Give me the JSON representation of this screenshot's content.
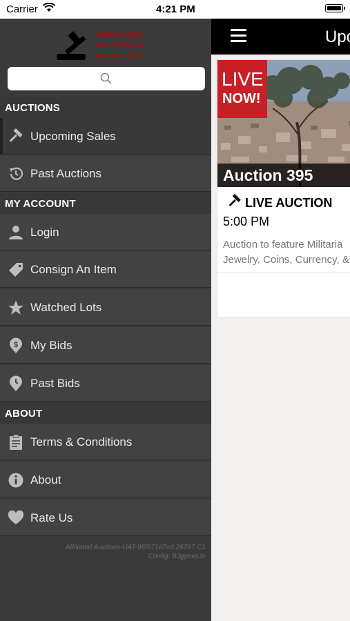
{
  "status": {
    "carrier": "Carrier",
    "time": "4:21 PM"
  },
  "brand": {
    "logo_text": [
      "AFFILIATED",
      "AUCTIONS &",
      "REALTY LLC"
    ]
  },
  "search": {
    "placeholder": ""
  },
  "sidebar": {
    "sections": [
      {
        "title": "AUCTIONS",
        "items": [
          {
            "label": "Upcoming Sales",
            "icon": "gavel-icon"
          },
          {
            "label": "Past Auctions",
            "icon": "history-icon"
          }
        ]
      },
      {
        "title": "MY ACCOUNT",
        "items": [
          {
            "label": "Login",
            "icon": "person-icon"
          },
          {
            "label": "Consign An Item",
            "icon": "tag-icon"
          },
          {
            "label": "Watched Lots",
            "icon": "star-icon"
          },
          {
            "label": "My Bids",
            "icon": "dollar-pin-icon"
          },
          {
            "label": "Past Bids",
            "icon": "clock-pin-icon"
          }
        ]
      },
      {
        "title": "ABOUT",
        "items": [
          {
            "label": "Terms & Conditions",
            "icon": "clipboard-icon"
          },
          {
            "label": "About",
            "icon": "info-icon"
          },
          {
            "label": "Rate Us",
            "icon": "heart-icon"
          }
        ]
      }
    ],
    "footer": {
      "line1": "Affiliated Auctions-UAT-96f571d7ed.26767.C1",
      "line2": "Config: BJgyexeJo"
    }
  },
  "main": {
    "page_title": "Upcoming Sales",
    "card": {
      "live_line1": "LIVE",
      "live_line2": "NOW!",
      "auction_title": "Auction 395",
      "type": "LIVE AUCTION",
      "time": "5:00 PM",
      "desc_line1": "Auction to feature Militaria",
      "desc_line2": "Jewelry, Coins, Currency, &"
    }
  },
  "colors": {
    "sidebar_bg": "#424242",
    "live_red": "#c72127",
    "topbar": "#000000"
  }
}
